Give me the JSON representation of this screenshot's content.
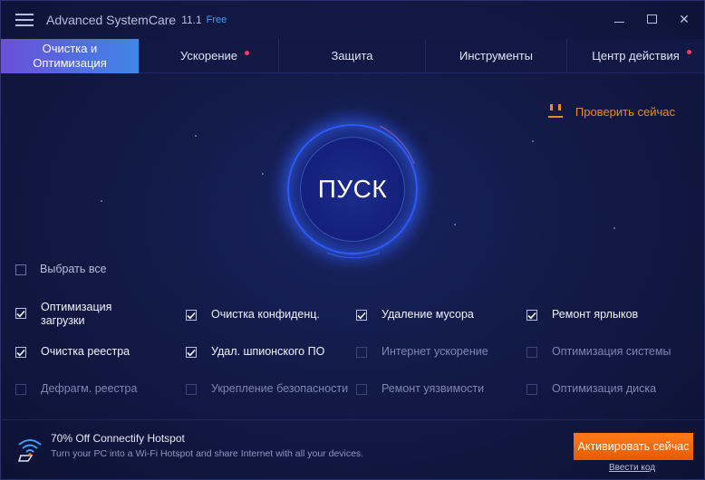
{
  "window": {
    "title": "Advanced SystemCare",
    "version": "11.1",
    "edition": "Free",
    "close_glyph": "✕"
  },
  "tabs": [
    {
      "label_line1": "Очистка и",
      "label_line2": "Оптимизация",
      "active": true,
      "dot": false
    },
    {
      "label": "Ускорение",
      "active": false,
      "dot": true
    },
    {
      "label": "Защита",
      "active": false,
      "dot": false
    },
    {
      "label": "Инструменты",
      "active": false,
      "dot": false
    },
    {
      "label": "Центр действия",
      "active": false,
      "dot": true
    }
  ],
  "check_now": {
    "label": "Проверить сейчас",
    "icon": "smile-icon"
  },
  "start": {
    "label": "ПУСК"
  },
  "select_all": {
    "label": "Выбрать все",
    "checked": false
  },
  "items": [
    {
      "line1": "Оптимизация",
      "line2": "загрузки",
      "checked": true
    },
    {
      "label": "Очистка конфиденц.",
      "checked": true
    },
    {
      "label": "Удаление мусора",
      "checked": true
    },
    {
      "label": "Ремонт ярлыков",
      "checked": true
    },
    {
      "label": "Очистка реестра",
      "checked": true
    },
    {
      "label": "Удал. шпионского ПО",
      "checked": true
    },
    {
      "label": "Интернет ускорение",
      "checked": false
    },
    {
      "label": "Оптимизация системы",
      "checked": false
    },
    {
      "label": "Дефрагм. реестра",
      "checked": false
    },
    {
      "label": "Укрепление безопасности",
      "checked": false
    },
    {
      "label": "Ремонт уязвимости",
      "checked": false
    },
    {
      "label": "Оптимизация диска",
      "checked": false
    }
  ],
  "promo": {
    "title": "70% Off Connectify Hotspot",
    "subtitle": "Turn your PC into a Wi-Fi Hotspot and share Internet with all your devices.",
    "icon": "wifi-hotspot-icon"
  },
  "activate": {
    "label": "Активировать сейчас"
  },
  "enter_code": {
    "label": "Ввести код"
  },
  "colors": {
    "accent_orange": "#f08a1c",
    "active_tab_start": "#6a4fd9",
    "active_tab_end": "#3f86e6",
    "ring_blue": "#2c5cff",
    "edition_blue": "#3ea0ff",
    "notify_red": "#ff3b5c"
  }
}
